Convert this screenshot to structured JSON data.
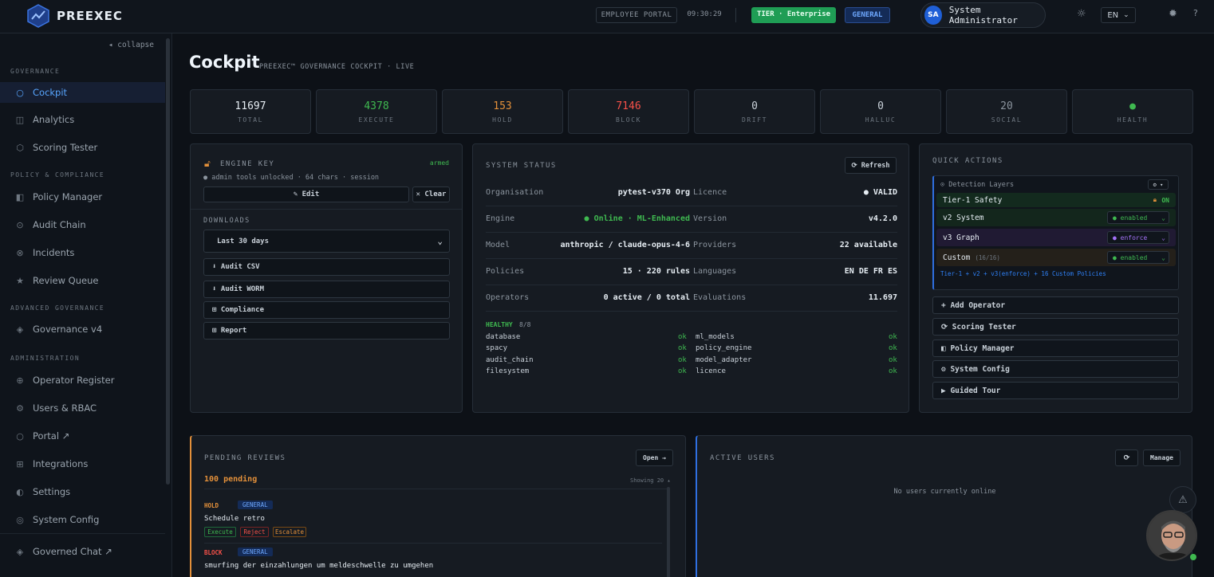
{
  "app": {
    "name": "PREEXEC"
  },
  "topbar": {
    "portal": "EMPLOYEE PORTAL",
    "time": "09:30:29",
    "tier": "TIER · Enterprise",
    "general": "GENERAL",
    "avatar_initials": "SA",
    "user_name": "System Administrator",
    "lang": "EN",
    "theme_icon": "sun-icon",
    "help": "?"
  },
  "sidebar": {
    "collapse": "◂ collapse",
    "sections": {
      "governance": "GOVERNANCE",
      "policy": "POLICY & COMPLIANCE",
      "advanced": "ADVANCED GOVERNANCE",
      "admin": "ADMINISTRATION"
    },
    "items": [
      {
        "label": "Cockpit",
        "icon": "circle-icon"
      },
      {
        "label": "Analytics",
        "icon": "square-icon"
      },
      {
        "label": "Scoring Tester",
        "icon": "hexagon-icon"
      },
      {
        "label": "Policy Manager",
        "icon": "book-icon"
      },
      {
        "label": "Audit Chain",
        "icon": "target-icon"
      },
      {
        "label": "Incidents",
        "icon": "x-circle-icon"
      },
      {
        "label": "Review Queue",
        "icon": "star-icon"
      },
      {
        "label": "Governance v4",
        "icon": "diamond-icon"
      },
      {
        "label": "Operator Register",
        "icon": "plus-circle-icon"
      },
      {
        "label": "Users & RBAC",
        "icon": "gear-icon"
      },
      {
        "label": "Portal ↗",
        "icon": "circle-icon"
      },
      {
        "label": "Integrations",
        "icon": "grid-icon"
      },
      {
        "label": "Settings",
        "icon": "half-circle-icon"
      },
      {
        "label": "System Config",
        "icon": "circle-dot-icon"
      },
      {
        "label": "Governed Chat ↗",
        "icon": "diamond-icon"
      }
    ]
  },
  "page": {
    "title": "Cockpit",
    "subtitle": "PREEXEC™ GOVERNANCE COCKPIT · LIVE"
  },
  "stats": [
    {
      "value": "11697",
      "label": "TOTAL",
      "color": "#e6edf3"
    },
    {
      "value": "4378",
      "label": "EXECUTE",
      "color": "#3fb950"
    },
    {
      "value": "153",
      "label": "HOLD",
      "color": "#e3903a"
    },
    {
      "value": "7146",
      "label": "BLOCK",
      "color": "#f85149"
    },
    {
      "value": "0",
      "label": "DRIFT",
      "color": "#c9d1d9"
    },
    {
      "value": "0",
      "label": "HALLUC",
      "color": "#c9d1d9"
    },
    {
      "value": "20",
      "label": "SOCIAL",
      "color": "#8b949e"
    },
    {
      "value": "●",
      "label": "HEALTH",
      "color": "#3fb950"
    }
  ],
  "engine_key": {
    "title": "ENGINE KEY",
    "status": "armed",
    "info": "● admin tools unlocked · 64 chars · session",
    "edit": "✎ Edit",
    "clear": "✕ Clear"
  },
  "downloads": {
    "title": "DOWNLOADS",
    "range": "Last 30 days",
    "items": [
      "⬇ Audit CSV",
      "⬇ Audit WORM",
      "⊞ Compliance",
      "⊞ Report"
    ]
  },
  "system_status": {
    "title": "SYSTEM STATUS",
    "refresh": "⟳ Refresh",
    "rows": [
      {
        "l1": "Organisation",
        "v1": "pytest-v370 Org",
        "l2": "Licence",
        "v2": "● VALID"
      },
      {
        "l1": "Engine",
        "v1": "● Online · ML-Enhanced",
        "l2": "Version",
        "v2": "v4.2.0"
      },
      {
        "l1": "Model",
        "v1": "anthropic / claude-opus-4-6",
        "l2": "Providers",
        "v2": "22 available"
      },
      {
        "l1": "Policies",
        "v1": "15 · 220 rules",
        "l2": "Languages",
        "v2": "EN DE FR ES"
      },
      {
        "l1": "Operators",
        "v1": "0 active / 0 total",
        "l2": "Evaluations",
        "v2": "11.697"
      }
    ],
    "healthy_label": "HEALTHY",
    "healthy_count": "8/8",
    "checks": [
      {
        "name": "database",
        "status": "ok"
      },
      {
        "name": "ml_models",
        "status": "ok"
      },
      {
        "name": "spacy",
        "status": "ok"
      },
      {
        "name": "policy_engine",
        "status": "ok"
      },
      {
        "name": "audit_chain",
        "status": "ok"
      },
      {
        "name": "model_adapter",
        "status": "ok"
      },
      {
        "name": "filesystem",
        "status": "ok"
      },
      {
        "name": "licence",
        "status": "ok"
      }
    ]
  },
  "quick_actions": {
    "title": "QUICK ACTIONS",
    "detection_title": "⊙ Detection Layers",
    "detection_btn": "⚙ ▾",
    "layers": [
      {
        "name": "Tier-1 Safety",
        "state": "ON"
      },
      {
        "name": "v2 System",
        "state": "● enabled"
      },
      {
        "name": "v3 Graph",
        "state": "● enforce"
      },
      {
        "name": "Custom",
        "count": "(16/16)",
        "state": "● enabled"
      }
    ],
    "summary": "Tier-1 + v2 + v3(enforce) + 16 Custom Policies",
    "buttons": [
      "+ Add Operator",
      "⟳ Scoring Tester",
      "◧ Policy Manager",
      "⚙ System Config",
      "▶ Guided Tour"
    ]
  },
  "pending": {
    "title": "PENDING REVIEWS",
    "open": "Open →",
    "count": "100 pending",
    "showing": "Showing 20 ▴",
    "items": [
      {
        "status": "HOLD",
        "tag": "GENERAL",
        "text": "Schedule retro",
        "actions": [
          "Execute",
          "Reject",
          "Escalate"
        ]
      },
      {
        "status": "BLOCK",
        "tag": "GENERAL",
        "text": "smurfing der einzahlungen um meldeschwelle zu umgehen"
      }
    ]
  },
  "active_users": {
    "title": "ACTIVE USERS",
    "refresh": "⟳",
    "manage": "Manage",
    "empty": "No users currently online"
  }
}
